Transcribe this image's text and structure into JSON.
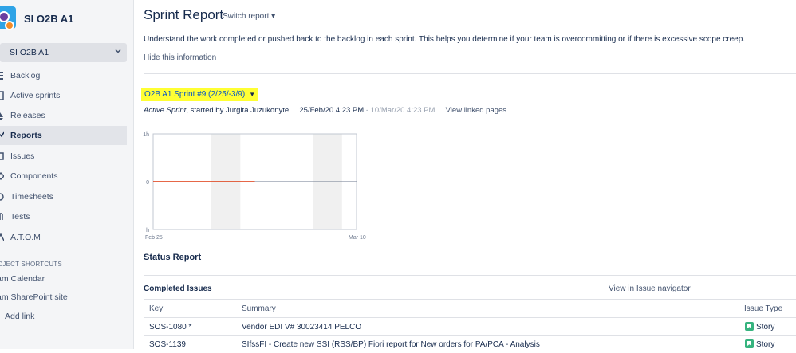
{
  "sidebar": {
    "project_name": "SI O2B A1",
    "board_name": "SI O2B A1",
    "items": [
      {
        "label": "Backlog",
        "active": false
      },
      {
        "label": "Active sprints",
        "active": false
      },
      {
        "label": "Releases",
        "active": false
      },
      {
        "label": "Reports",
        "active": true
      },
      {
        "label": "Issues",
        "active": false
      },
      {
        "label": "Components",
        "active": false
      },
      {
        "label": "Timesheets",
        "active": false
      },
      {
        "label": "Tests",
        "active": false
      },
      {
        "label": "A.T.O.M",
        "active": false
      }
    ],
    "shortcuts_title": "OJECT SHORTCUTS",
    "shortcuts": [
      "am Calendar",
      "am SharePoint site"
    ],
    "add_link": "Add link"
  },
  "header": {
    "title": "Sprint Report",
    "switch_report": "Switch report"
  },
  "info": {
    "description": "Understand the work completed or pushed back to the backlog in each sprint. This helps you determine if your team is overcommitting or if there is excessive scope creep.",
    "hide_link": "Hide this information"
  },
  "sprint": {
    "selector_label": "O2B A1 Sprint #9 (2/25/-3/9)",
    "status": "Active Sprint",
    "started_by": ", started by Jurgita Juzukonyte",
    "start_date": "25/Feb/20 4:23 PM",
    "separator": " - ",
    "end_date": "10/Mar/20 4:23 PM",
    "view_linked": "View linked pages"
  },
  "chart_data": {
    "type": "line",
    "y_tick_labels": [
      "1h",
      "0",
      "h"
    ],
    "x_tick_labels": [
      "Feb 25",
      "Mar 10"
    ],
    "series": [
      {
        "values_description_none": "",
        "color": "#DE350B",
        "x": [
          "Feb 25",
          "Mar 3"
        ],
        "y": [
          0,
          0
        ]
      },
      {
        "color": "#6B778C",
        "x": [
          "Mar 3",
          "Mar 10"
        ],
        "y": [
          0,
          0
        ]
      }
    ],
    "ylim": [
      -1,
      1
    ]
  },
  "status_report": {
    "title": "Status Report",
    "completed_title": "Completed Issues",
    "view_in_navigator": "View in Issue navigator",
    "columns": [
      "Key",
      "Summary",
      "Issue Type"
    ],
    "rows": [
      {
        "key": "SOS-1080 *",
        "summary": "Vendor EDI V# 30023414 PELCO",
        "type": "Story"
      },
      {
        "key": "SOS-1139",
        "summary": "SIfssFI - Create new SSI (RSS/BP) Fiori report for New orders for PA/PCA - Analysis",
        "type": "Story"
      }
    ]
  },
  "colors": {
    "sidebar_bg": "#F4F5F7",
    "highlight": "#FFFF33",
    "burndown_red": "#DE350B",
    "story_green": "#36B37E",
    "nonworking_band": "#F0F0F0"
  }
}
